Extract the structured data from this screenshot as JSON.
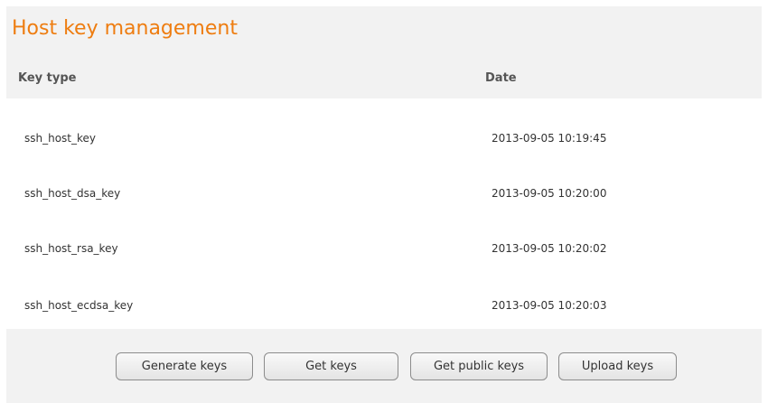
{
  "page": {
    "title": "Host key management"
  },
  "table": {
    "columns": {
      "key_type": "Key type",
      "date": "Date"
    },
    "rows": [
      {
        "key_type": "ssh_host_key",
        "date": "2013-09-05 10:19:45"
      },
      {
        "key_type": "ssh_host_dsa_key",
        "date": "2013-09-05 10:20:00"
      },
      {
        "key_type": "ssh_host_rsa_key",
        "date": "2013-09-05 10:20:02"
      },
      {
        "key_type": "ssh_host_ecdsa_key",
        "date": "2013-09-05 10:20:03"
      }
    ]
  },
  "buttons": {
    "generate": "Generate keys",
    "get": "Get keys",
    "get_public": "Get public keys",
    "upload": "Upload keys"
  },
  "colors": {
    "accent": "#ee7d11",
    "panel_background": "#f2f2f2",
    "table_background": "#ffffff"
  }
}
